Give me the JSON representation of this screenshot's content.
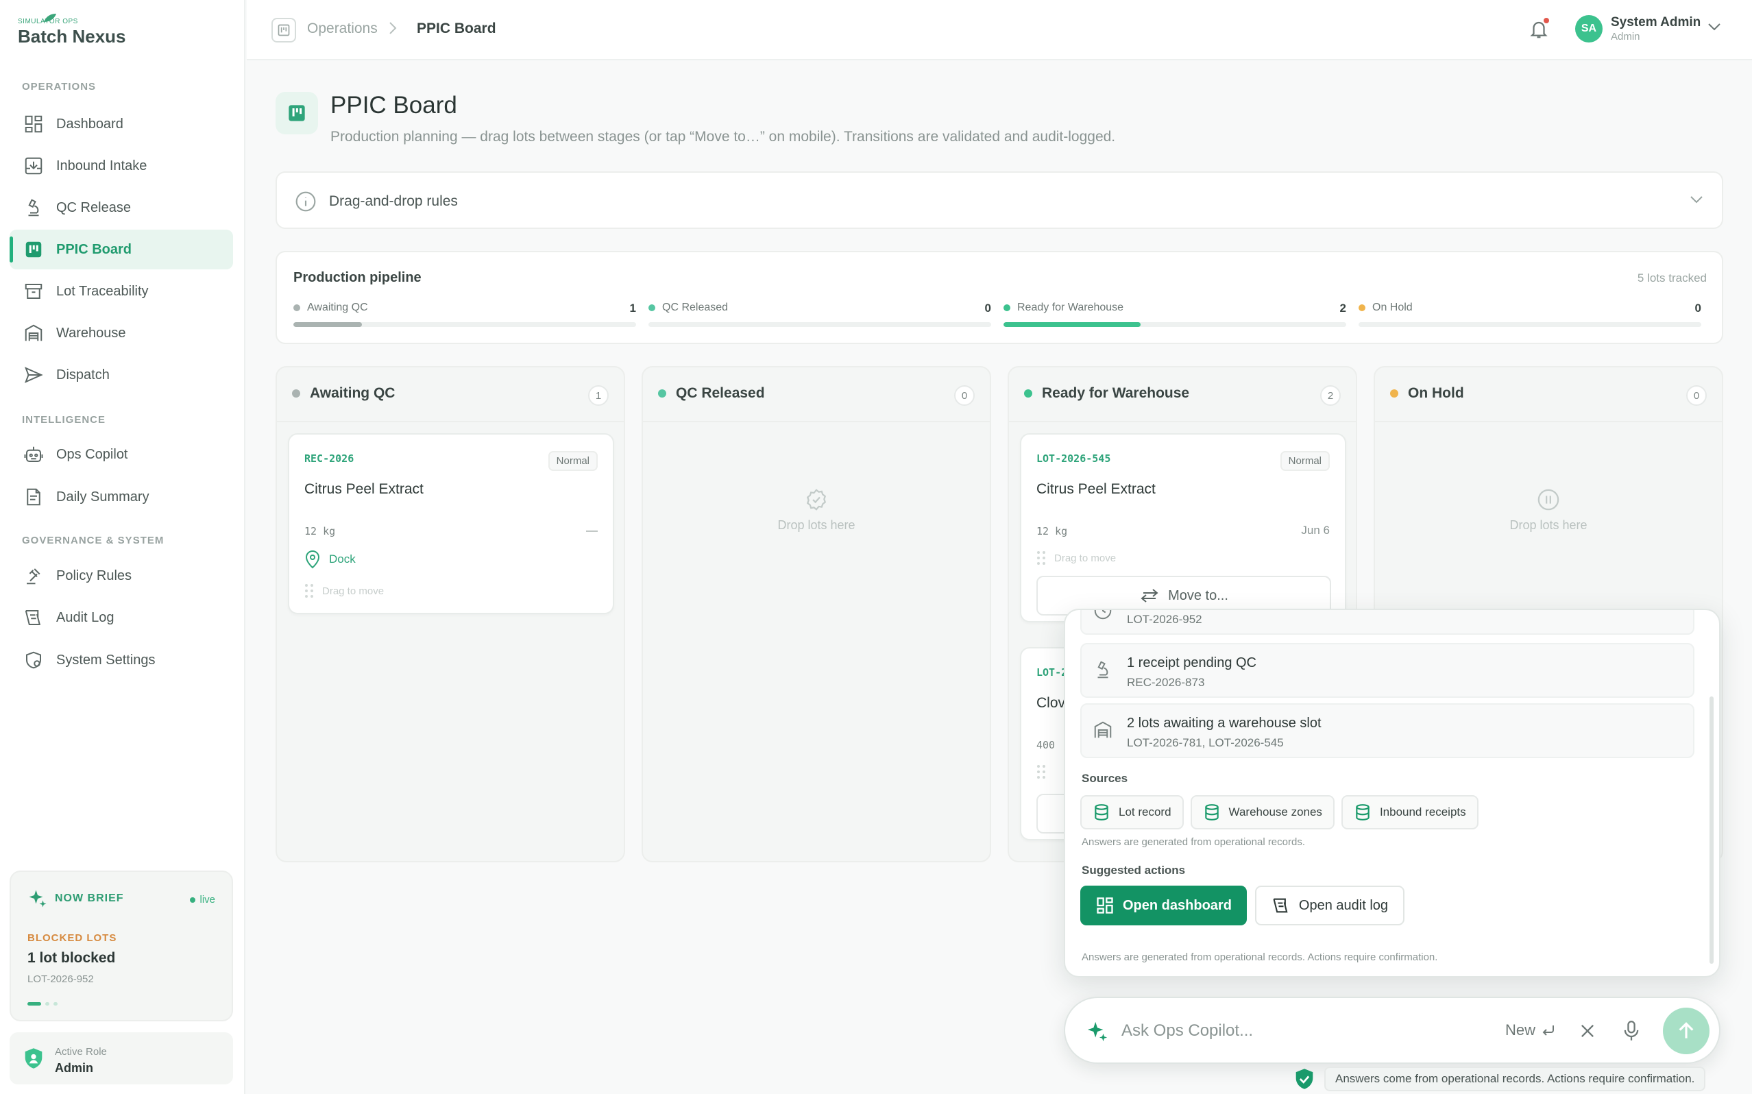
{
  "brand": {
    "tagline": "SIMULATOR OPS",
    "name": "Batch Nexus"
  },
  "sidebar": {
    "sections": [
      {
        "title": "OPERATIONS",
        "items": [
          {
            "label": "Dashboard",
            "icon": "dashboard-icon"
          },
          {
            "label": "Inbound Intake",
            "icon": "inbox-download-icon"
          },
          {
            "label": "QC Release",
            "icon": "microscope-icon"
          },
          {
            "label": "PPIC Board",
            "icon": "kanban-icon",
            "active": true
          },
          {
            "label": "Lot Traceability",
            "icon": "archive-box-icon"
          },
          {
            "label": "Warehouse",
            "icon": "warehouse-icon"
          },
          {
            "label": "Dispatch",
            "icon": "send-icon"
          }
        ]
      },
      {
        "title": "INTELLIGENCE",
        "items": [
          {
            "label": "Ops Copilot",
            "icon": "robot-icon"
          },
          {
            "label": "Daily Summary",
            "icon": "document-icon"
          }
        ]
      },
      {
        "title": "GOVERNANCE & SYSTEM",
        "items": [
          {
            "label": "Policy Rules",
            "icon": "gavel-icon"
          },
          {
            "label": "Audit Log",
            "icon": "audit-icon"
          },
          {
            "label": "System Settings",
            "icon": "settings-shield-icon"
          }
        ]
      }
    ],
    "brief": {
      "title": "NOW BRIEF",
      "status": "live",
      "label": "BLOCKED LOTS",
      "value": "1 lot blocked",
      "sub": "LOT-2026-952"
    },
    "role": {
      "label": "Active Role",
      "value": "Admin"
    }
  },
  "topbar": {
    "breadcrumb": [
      "Operations",
      "PPIC Board"
    ],
    "user": {
      "initials": "SA",
      "name": "System Admin",
      "role": "Admin"
    }
  },
  "page": {
    "title": "PPIC Board",
    "subtitle": "Production planning — drag lots between stages (or tap “Move to…” on mobile). Transitions are validated and audit-logged.",
    "rules_label": "Drag-and-drop rules"
  },
  "pipeline": {
    "title": "Production pipeline",
    "tracked": "5 lots tracked",
    "stages": [
      {
        "name": "Awaiting QC",
        "count": "1",
        "share": 0.2,
        "color": "#aab3b1"
      },
      {
        "name": "QC Released",
        "count": "0",
        "share": 0,
        "color": "#56c6a2"
      },
      {
        "name": "Ready for Warehouse",
        "count": "2",
        "share": 0.4,
        "color": "#3cc28e"
      },
      {
        "name": "On Hold",
        "count": "0",
        "share": 0,
        "color": "#f0b44c"
      }
    ]
  },
  "board": {
    "columns": [
      {
        "name": "Awaiting QC",
        "count": "1",
        "color": "#aab3b1"
      },
      {
        "name": "QC Released",
        "count": "0",
        "color": "#56c6a2",
        "empty": "Drop lots here"
      },
      {
        "name": "Ready for Warehouse",
        "count": "2",
        "color": "#3cc28e"
      },
      {
        "name": "On Hold",
        "count": "0",
        "color": "#f0b44c",
        "empty": "Drop lots here"
      }
    ],
    "cards": {
      "awaiting": {
        "id": "REC-2026",
        "badge": "Normal",
        "name": "Citrus Peel Extract",
        "qty": "12  kg",
        "date": "—",
        "location": "Dock",
        "drag": "Drag to move"
      },
      "ready1": {
        "id": "LOT-2026-545",
        "badge": "Normal",
        "name": "Citrus Peel Extract",
        "qty": "12  kg",
        "date": "Jun 6",
        "drag": "Drag to move",
        "move": "Move to..."
      },
      "ready2": {
        "id": "LOT-2",
        "name": "Clov",
        "qty": "400"
      }
    }
  },
  "copilot": {
    "items": [
      {
        "title": "",
        "sub": "LOT-2026-952"
      },
      {
        "title": "1 receipt pending QC",
        "sub": "REC-2026-873"
      },
      {
        "title": "2 lots awaiting a warehouse slot",
        "sub": "LOT-2026-781, LOT-2026-545"
      }
    ],
    "sources_title": "Sources",
    "sources": [
      "Lot record",
      "Warehouse zones",
      "Inbound receipts"
    ],
    "sources_note": "Answers are generated from operational records.",
    "actions_title": "Suggested actions",
    "actions": {
      "primary": "Open dashboard",
      "secondary": "Open audit log"
    },
    "footer_note": "Answers are generated from operational records. Actions require confirmation.",
    "ask": {
      "placeholder": "Ask Ops Copilot...",
      "new_label": "New"
    }
  },
  "disclaimer": "Answers come from operational records. Actions require confirmation."
}
